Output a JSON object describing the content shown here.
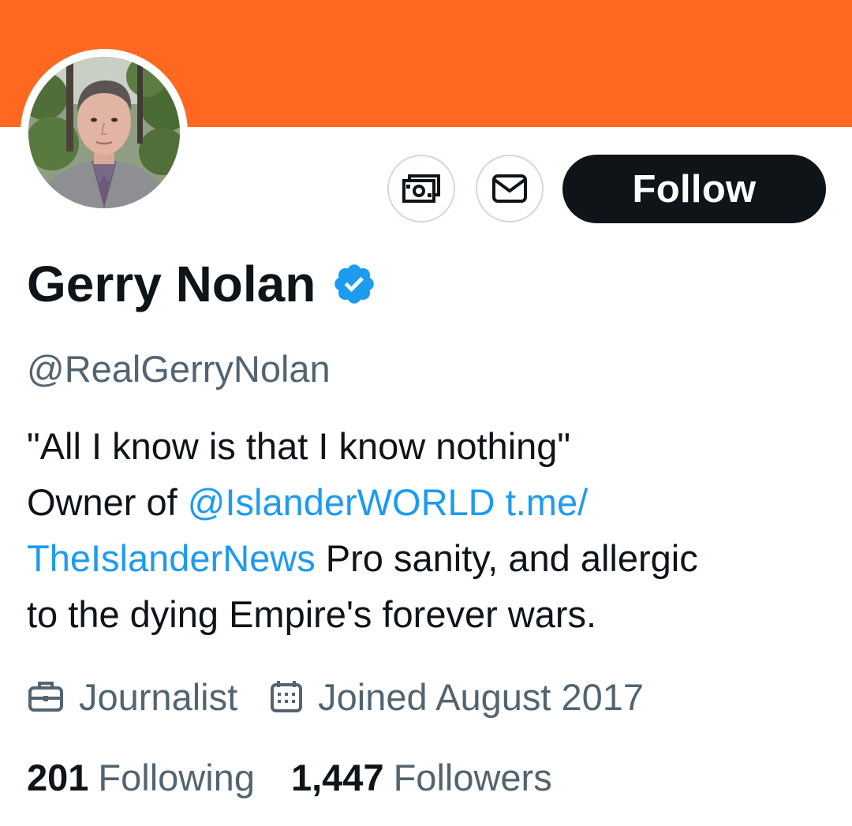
{
  "profile": {
    "display_name": "Gerry Nolan",
    "handle": "@RealGerryNolan",
    "verified": true,
    "banner_color": "#ff6820"
  },
  "actions": {
    "tip_icon": "money-icon",
    "message_icon": "envelope-icon",
    "follow_label": "Follow"
  },
  "bio": {
    "line1": "\"All I know is that I know nothing\"",
    "line2_text": "Owner of ",
    "mention": "@IslanderWORLD",
    "link_part1": "t.me/",
    "link_part2": "TheIslanderNews",
    "line3_rest": " Pro sanity, and allergic",
    "line4": "to the dying Empire's forever wars."
  },
  "meta": {
    "profession_icon": "briefcase-icon",
    "profession": "Journalist",
    "joined_icon": "calendar-icon",
    "joined": "Joined August 2017"
  },
  "stats": {
    "following_count": "201",
    "following_label": "Following",
    "followers_count": "1,447",
    "followers_label": "Followers"
  },
  "colors": {
    "accent": "#1d9bf0",
    "secondary_text": "#536471",
    "primary_text": "#0f1419"
  }
}
